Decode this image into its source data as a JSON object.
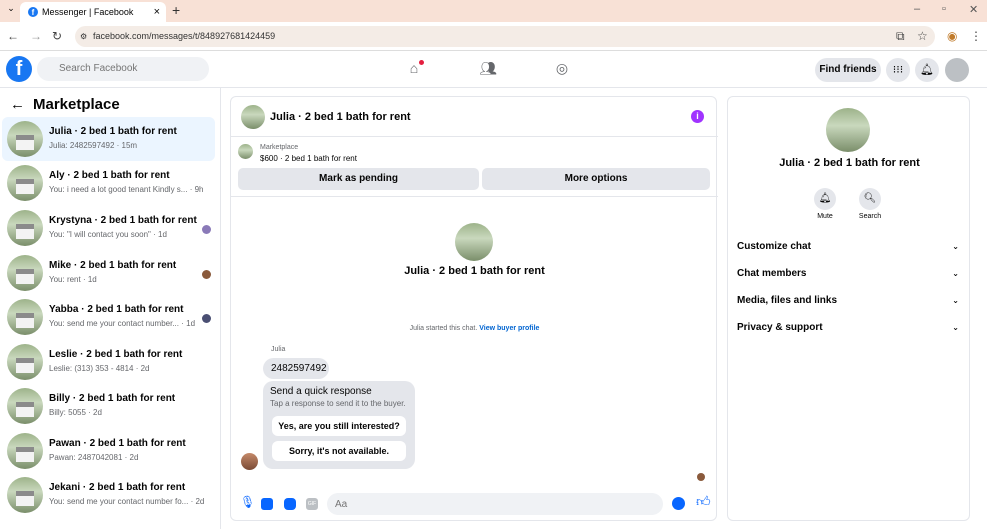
{
  "browser": {
    "tab_title": "Messenger | Facebook",
    "url": "facebook.com/messages/t/848927681424459"
  },
  "header": {
    "search_placeholder": "Search Facebook",
    "find_friends": "Find friends"
  },
  "sidebar": {
    "title": "Marketplace",
    "conversations": [
      {
        "title": "Julia · 2 bed 1 bath for rent",
        "snippet": "Julia: 2482597492 · 15m",
        "active": true
      },
      {
        "title": "Aly · 2 bed 1 bath for rent",
        "snippet": "You: i need a lot good tenant Kindly s... · 9h"
      },
      {
        "title": "Krystyna · 2 bed 1 bath for rent",
        "snippet": "You: \"I will contact you soon\" · 1d"
      },
      {
        "title": "Mike · 2 bed 1 bath for rent",
        "snippet": "You: rent · 1d"
      },
      {
        "title": "Yabba · 2 bed 1 bath for rent",
        "snippet": "You: send me your contact number... · 1d"
      },
      {
        "title": "Leslie · 2 bed 1 bath for rent",
        "snippet": "Leslie: (313) 353 - 4814 · 2d"
      },
      {
        "title": "Billy · 2 bed 1 bath for rent",
        "snippet": "Billy: 5055 · 2d"
      },
      {
        "title": "Pawan · 2 bed 1 bath for rent",
        "snippet": "Pawan: 2487042081 · 2d"
      },
      {
        "title": "Jekani · 2 bed 1 bath for rent",
        "snippet": "You: send me your contact number fo... · 2d"
      }
    ]
  },
  "chat": {
    "title": "Julia · 2 bed 1 bath for rent",
    "marketplace_label": "Marketplace",
    "listing": "$600 · 2 bed 1 bath for rent",
    "mark_pending": "Mark as pending",
    "more_options": "More options",
    "intro_title": "Julia · 2 bed 1 bath for rent",
    "started_text": "Julia started this chat.",
    "view_profile": "View buyer profile",
    "sender": "Julia",
    "message": "2482597492",
    "quick_title": "Send a quick response",
    "quick_sub": "Tap a response to send it to the buyer.",
    "quick_1": "Yes, are you still interested?",
    "quick_2": "Sorry, it's not available.",
    "input_placeholder": "Aa"
  },
  "details": {
    "title": "Julia · 2 bed 1 bath for rent",
    "mute": "Mute",
    "search": "Search",
    "sections": [
      "Customize chat",
      "Chat members",
      "Media, files and links",
      "Privacy & support"
    ]
  }
}
